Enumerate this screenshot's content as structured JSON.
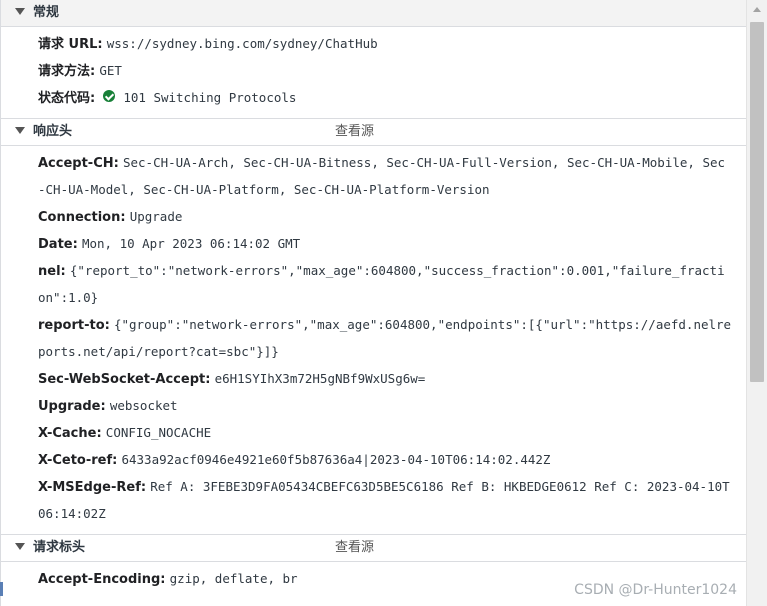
{
  "general": {
    "title": "常规",
    "rows": [
      {
        "key": "请求 URL:",
        "value": "wss://sydney.bing.com/sydney/ChatHub"
      },
      {
        "key": "请求方法:",
        "value": "GET"
      },
      {
        "key": "状态代码:",
        "value": "101 Switching Protocols"
      }
    ]
  },
  "response_headers": {
    "title": "响应头",
    "view_source": "查看源",
    "rows": [
      {
        "key": "Accept-CH:",
        "value": "Sec-CH-UA-Arch, Sec-CH-UA-Bitness, Sec-CH-UA-Full-Version, Sec-CH-UA-Mobile, Sec-CH-UA-Model, Sec-CH-UA-Platform, Sec-CH-UA-Platform-Version"
      },
      {
        "key": "Connection:",
        "value": "Upgrade"
      },
      {
        "key": "Date:",
        "value": "Mon, 10 Apr 2023 06:14:02 GMT"
      },
      {
        "key": "nel:",
        "value": "{\"report_to\":\"network-errors\",\"max_age\":604800,\"success_fraction\":0.001,\"failure_fraction\":1.0}"
      },
      {
        "key": "report-to:",
        "value": "{\"group\":\"network-errors\",\"max_age\":604800,\"endpoints\":[{\"url\":\"https://aefd.nelreports.net/api/report?cat=sbc\"}]}"
      },
      {
        "key": "Sec-WebSocket-Accept:",
        "value": "e6H1SYIhX3m72H5gNBf9WxUSg6w="
      },
      {
        "key": "Upgrade:",
        "value": "websocket"
      },
      {
        "key": "X-Cache:",
        "value": "CONFIG_NOCACHE"
      },
      {
        "key": "X-Ceto-ref:",
        "value": "6433a92acf0946e4921e60f5b87636a4|2023-04-10T06:14:02.442Z"
      },
      {
        "key": "X-MSEdge-Ref:",
        "value": "Ref A: 3FEBE3D9FA05434CBEFC63D5BE5C6186 Ref B: HKBEDGE0612 Ref C: 2023-04-10T06:14:02Z"
      }
    ]
  },
  "request_headers": {
    "title": "请求标头",
    "view_source": "查看源",
    "rows": [
      {
        "key": "Accept-Encoding:",
        "value": "gzip, deflate, br"
      }
    ]
  },
  "watermark": "CSDN @Dr-Hunter1024"
}
